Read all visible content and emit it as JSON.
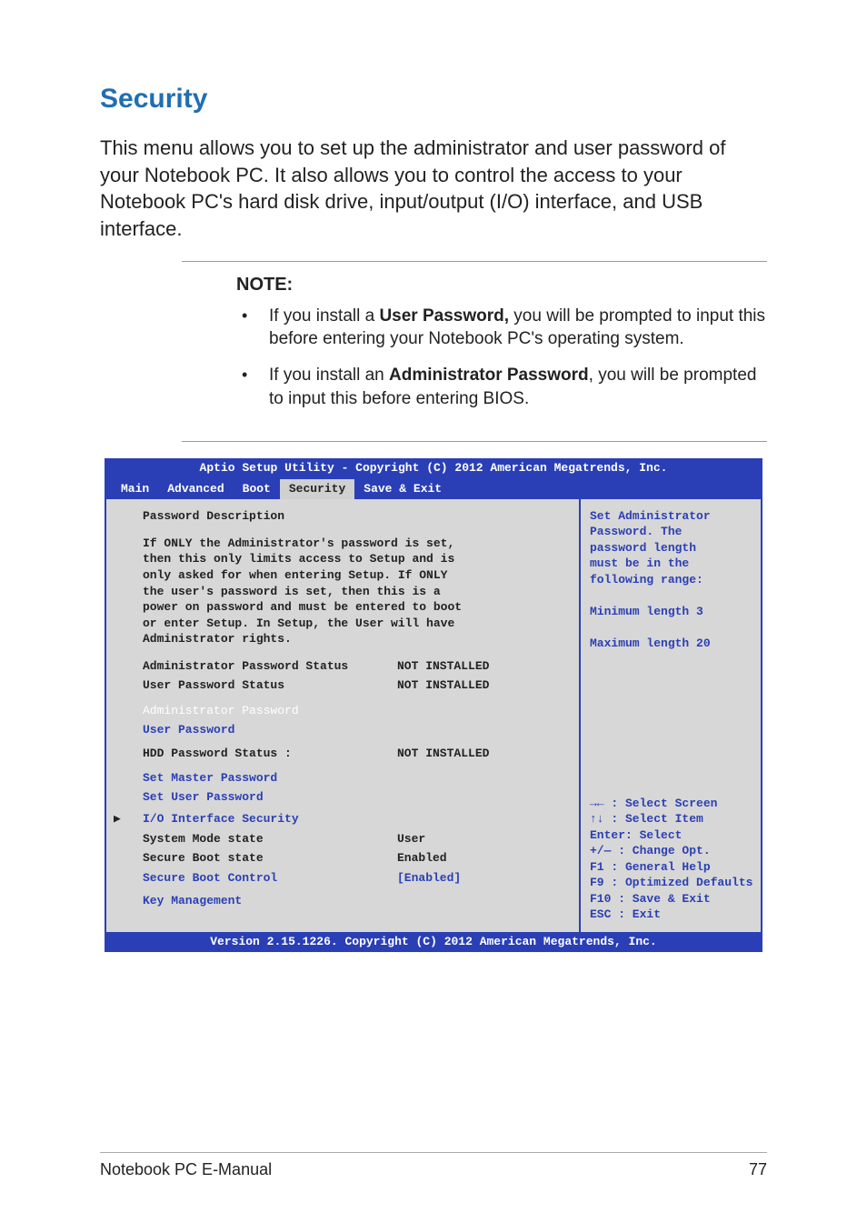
{
  "heading": "Security",
  "intro": "This menu allows you to set up the administrator and user password of your Notebook PC. It also allows you to control the access to your Notebook PC's hard disk drive, input/output (I/O) interface, and USB interface.",
  "note": {
    "label": "NOTE:",
    "items": [
      {
        "pre": "If you install a ",
        "strong": "User Password,",
        "post": " you will be prompted to input this before entering your Notebook PC's operating system."
      },
      {
        "pre": "If you install an ",
        "strong": "Administrator Password",
        "post": ", you will be prompted to input this before entering BIOS."
      }
    ]
  },
  "bios": {
    "title": "Aptio Setup Utility - Copyright (C) 2012 American Megatrends, Inc.",
    "tabs": [
      "Main",
      "Advanced",
      "Boot",
      "Security",
      "Save & Exit"
    ],
    "active_tab": "Security",
    "left": {
      "pd_title": "Password Description",
      "desc": "If ONLY the Administrator's password is set,\nthen this only limits access to Setup and is\nonly asked for when entering Setup. If ONLY\nthe user's password is set, then this is a\npower on password and must be entered to boot\nor enter Setup. In Setup, the User will have\nAdministrator rights.",
      "rows1": [
        {
          "lbl": "Administrator Password Status",
          "val": "NOT INSTALLED"
        },
        {
          "lbl": "User Password Status",
          "val": "NOT INSTALLED"
        }
      ],
      "selected": "Administrator Password",
      "link_user_pw": "User Password",
      "rows2": [
        {
          "lbl": "HDD Password Status :",
          "val": "NOT INSTALLED"
        }
      ],
      "link_master": "Set Master Password",
      "link_setuser": "Set User Password",
      "link_io": "I/O Interface Security",
      "rows3": [
        {
          "lbl": "System Mode state",
          "val": "User"
        },
        {
          "lbl": "Secure Boot state",
          "val": "Enabled"
        }
      ],
      "link_sbc_lbl": "Secure Boot Control",
      "link_sbc_val": "[Enabled]",
      "link_km": "Key Management"
    },
    "right": {
      "help_top": "Set Administrator\nPassword. The\npassword length\nmust be in the\nfollowing range:\n\nMinimum length 3\n\nMaximum length 20",
      "help_bot": [
        "→←  : Select Screen",
        "↑↓   : Select Item",
        "Enter: Select",
        "+/—  : Change Opt.",
        "F1   : General Help",
        "F9   : Optimized Defaults",
        "F10  : Save & Exit",
        "ESC  : Exit"
      ]
    },
    "footer": "Version 2.15.1226. Copyright (C) 2012 American Megatrends, Inc."
  },
  "page_footer": {
    "left": "Notebook PC E-Manual",
    "right": "77"
  }
}
